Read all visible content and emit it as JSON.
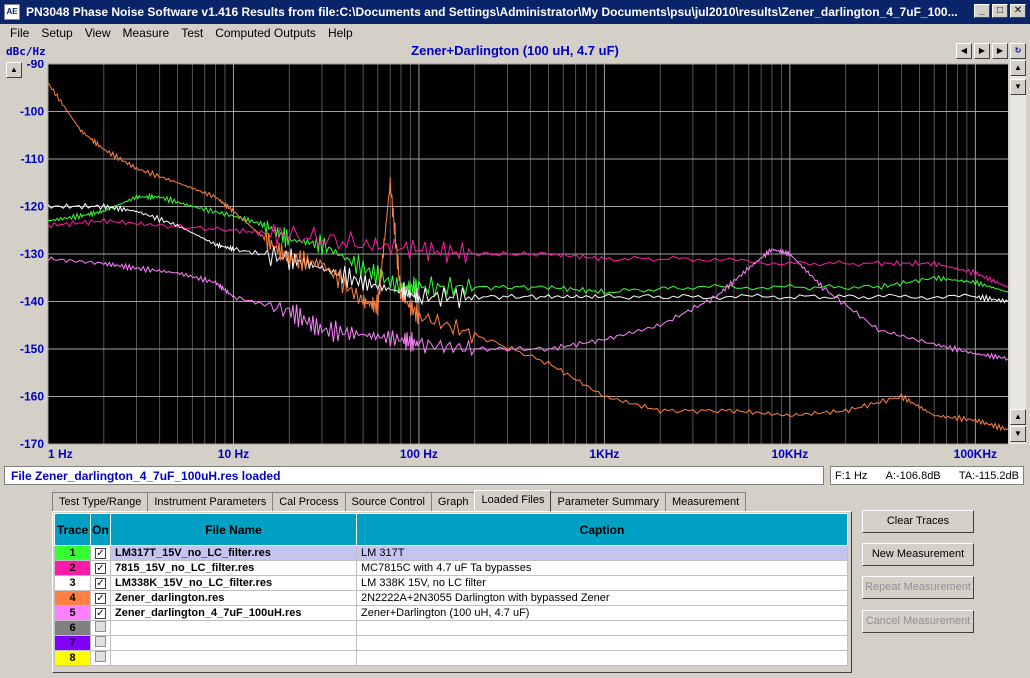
{
  "window": {
    "title": "PN3048 Phase Noise Software v1.416    Results from file:C:\\Documents and Settings\\Administrator\\My Documents\\psu\\jul2010\\results\\Zener_darlington_4_7uF_100...",
    "icon_text": "AE",
    "minimize": "_",
    "maximize": "□",
    "close": "✕"
  },
  "menu": [
    "File",
    "Setup",
    "View",
    "Measure",
    "Test",
    "Computed Outputs",
    "Help"
  ],
  "graph": {
    "units": "dBc/Hz",
    "title": "Zener+Darlington (100 uH, 4.7 uF)"
  },
  "chart_data": {
    "type": "line",
    "title": "Zener+Darlington (100 uH, 4.7 uF)",
    "ylabel": "dBc/Hz",
    "xlabel": "",
    "xscale": "log",
    "xlim": [
      1,
      150000
    ],
    "ylim": [
      -170,
      -90
    ],
    "yticks": [
      "-90",
      "-100",
      "-110",
      "-120",
      "-130",
      "-140",
      "-150",
      "-160",
      "-170"
    ],
    "xticks": [
      "1 Hz",
      "10 Hz",
      "100 Hz",
      "1KHz",
      "10KHz",
      "100KHz"
    ],
    "grid": true,
    "background": "#000000",
    "series": [
      {
        "trace": 1,
        "color": "#33ff33",
        "points": [
          [
            1,
            -123
          ],
          [
            1.5,
            -122
          ],
          [
            2,
            -121
          ],
          [
            3,
            -118
          ],
          [
            4,
            -118
          ],
          [
            6,
            -120
          ],
          [
            10,
            -122
          ],
          [
            15,
            -124
          ],
          [
            20,
            -127
          ],
          [
            30,
            -128
          ],
          [
            50,
            -133
          ],
          [
            80,
            -137
          ],
          [
            100,
            -137
          ],
          [
            200,
            -137
          ],
          [
            500,
            -137
          ],
          [
            1000,
            -138
          ],
          [
            3000,
            -137
          ],
          [
            10000,
            -137
          ],
          [
            30000,
            -137
          ],
          [
            60000,
            -135
          ],
          [
            100000,
            -136
          ],
          [
            150000,
            -138
          ]
        ]
      },
      {
        "trace": 2,
        "color": "#ff1aa8",
        "points": [
          [
            1,
            -124
          ],
          [
            2,
            -123
          ],
          [
            4,
            -124
          ],
          [
            10,
            -125
          ],
          [
            20,
            -126
          ],
          [
            50,
            -128
          ],
          [
            100,
            -129
          ],
          [
            200,
            -130
          ],
          [
            500,
            -130
          ],
          [
            1000,
            -131
          ],
          [
            3000,
            -131
          ],
          [
            10000,
            -132
          ],
          [
            30000,
            -132
          ],
          [
            60000,
            -132
          ],
          [
            100000,
            -134
          ],
          [
            150000,
            -137
          ]
        ]
      },
      {
        "trace": 3,
        "color": "#ffffff",
        "points": [
          [
            1,
            -120
          ],
          [
            2,
            -120
          ],
          [
            3,
            -121
          ],
          [
            5,
            -124
          ],
          [
            8,
            -128
          ],
          [
            10,
            -129
          ],
          [
            20,
            -131
          ],
          [
            30,
            -133
          ],
          [
            50,
            -136
          ],
          [
            80,
            -138
          ],
          [
            100,
            -139
          ],
          [
            200,
            -139
          ],
          [
            500,
            -139
          ],
          [
            1000,
            -139
          ],
          [
            3000,
            -139
          ],
          [
            10000,
            -139
          ],
          [
            30000,
            -139
          ],
          [
            100000,
            -139
          ],
          [
            150000,
            -140
          ]
        ]
      },
      {
        "trace": 4,
        "color": "#ff8040",
        "points": [
          [
            1,
            -94
          ],
          [
            1.5,
            -104
          ],
          [
            2,
            -108
          ],
          [
            3,
            -112
          ],
          [
            5,
            -115
          ],
          [
            8,
            -118
          ],
          [
            10,
            -121
          ],
          [
            15,
            -127
          ],
          [
            20,
            -131
          ],
          [
            30,
            -132
          ],
          [
            50,
            -140
          ],
          [
            60,
            -141
          ],
          [
            70,
            -115
          ],
          [
            80,
            -139
          ],
          [
            100,
            -143
          ],
          [
            200,
            -147
          ],
          [
            500,
            -153
          ],
          [
            1000,
            -160
          ],
          [
            2000,
            -163
          ],
          [
            5000,
            -163
          ],
          [
            10000,
            -164
          ],
          [
            20000,
            -163
          ],
          [
            40000,
            -160
          ],
          [
            60000,
            -164
          ],
          [
            100000,
            -165
          ],
          [
            150000,
            -167
          ]
        ]
      },
      {
        "trace": 5,
        "color": "#ff80ff",
        "points": [
          [
            1,
            -131
          ],
          [
            2,
            -132
          ],
          [
            3,
            -133
          ],
          [
            5,
            -134
          ],
          [
            8,
            -136
          ],
          [
            10,
            -139
          ],
          [
            20,
            -142
          ],
          [
            30,
            -146
          ],
          [
            50,
            -147
          ],
          [
            80,
            -148
          ],
          [
            100,
            -149
          ],
          [
            200,
            -150
          ],
          [
            500,
            -150
          ],
          [
            1000,
            -148
          ],
          [
            2000,
            -145
          ],
          [
            4000,
            -139
          ],
          [
            6000,
            -133
          ],
          [
            8000,
            -129
          ],
          [
            10000,
            -130
          ],
          [
            15000,
            -137
          ],
          [
            30000,
            -146
          ],
          [
            60000,
            -149
          ],
          [
            100000,
            -151
          ],
          [
            150000,
            -152
          ]
        ]
      }
    ]
  },
  "status": {
    "file": "File  Zener_darlington_4_7uF_100uH.res loaded",
    "freq": "F:1 Hz",
    "a": "A:-106.8dB",
    "ta": "TA:-115.2dB"
  },
  "tabs": [
    "Test Type/Range",
    "Instrument Parameters",
    "Cal Process",
    "Source Control",
    "Graph",
    "Loaded Files",
    "Parameter Summary",
    "Measurement"
  ],
  "active_tab": "Loaded Files",
  "table": {
    "headers": {
      "trace": "Trace",
      "on": "On",
      "file": "File Name",
      "caption": "Caption"
    },
    "rows": [
      {
        "num": "1",
        "color": "#33ff33",
        "on": true,
        "file": "LM317T_15V_no_LC_filter.res",
        "caption": "LM 317T"
      },
      {
        "num": "2",
        "color": "#ff1aa8",
        "on": true,
        "file": "7815_15V_no_LC_filter.res",
        "caption": "MC7815C with 4.7 uF Ta bypasses"
      },
      {
        "num": "3",
        "color": "#ffffff",
        "on": true,
        "file": "LM338K_15V_no_LC_filter.res",
        "caption": "LM 338K 15V, no LC filter"
      },
      {
        "num": "4",
        "color": "#ff8040",
        "on": true,
        "file": "Zener_darlington.res",
        "caption": "2N2222A+2N3055 Darlington with bypassed Zener"
      },
      {
        "num": "5",
        "color": "#ff80ff",
        "on": true,
        "file": "Zener_darlington_4_7uF_100uH.res",
        "caption": "Zener+Darlington (100 uH, 4.7 uF)"
      },
      {
        "num": "6",
        "color": "#808080",
        "on": false,
        "file": "",
        "caption": ""
      },
      {
        "num": "7",
        "color": "#8000ff",
        "on": false,
        "file": "",
        "caption": ""
      },
      {
        "num": "8",
        "color": "#ffff00",
        "on": false,
        "file": "",
        "caption": ""
      }
    ]
  },
  "buttons": {
    "clear": "Clear Traces",
    "new": "New Measurement",
    "repeat": "Repeat Measurement",
    "cancel": "Cancel Measurement"
  }
}
